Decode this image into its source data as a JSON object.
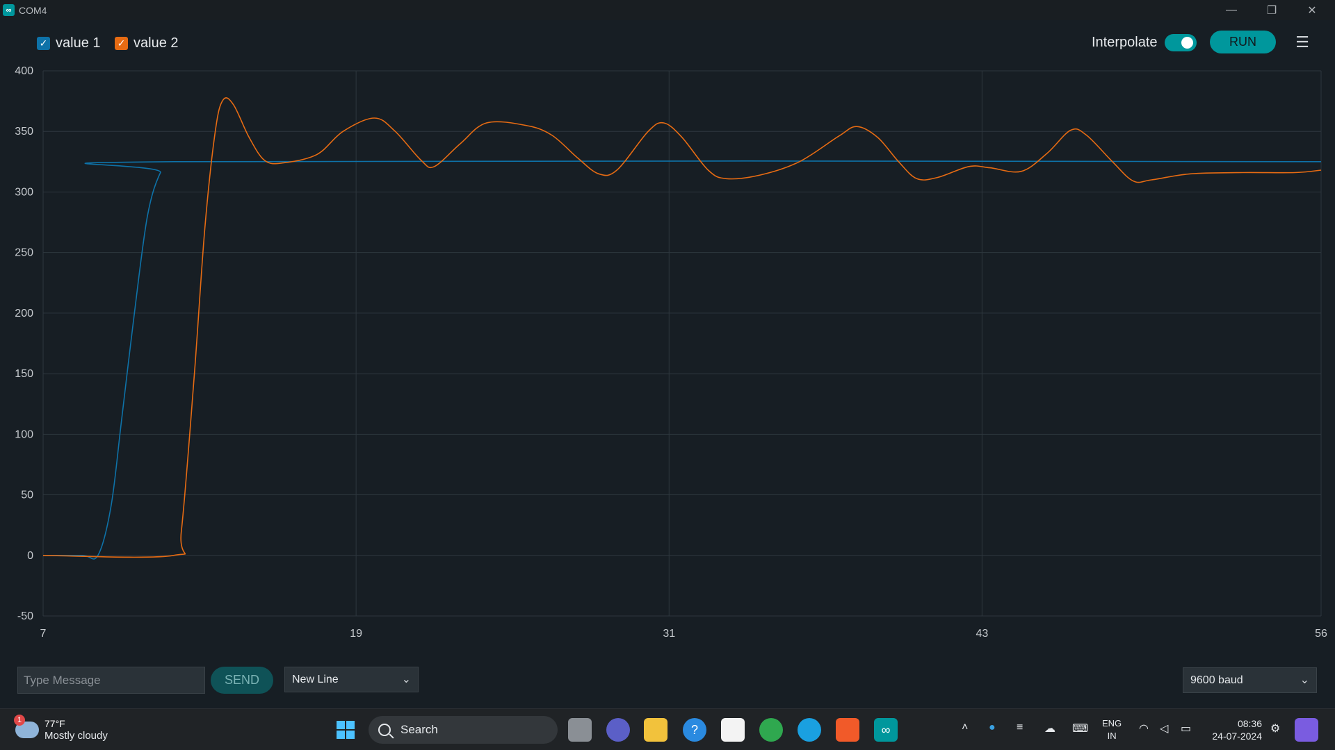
{
  "window": {
    "title": "COM4",
    "icon": "arduino-icon"
  },
  "legend": [
    {
      "label": "value 1",
      "color": "#0e72a8",
      "checked": true
    },
    {
      "label": "value 2",
      "color": "#e66b13",
      "checked": true
    }
  ],
  "toolbar": {
    "interpolate_label": "Interpolate",
    "interpolate_on": true,
    "run_label": "RUN",
    "menu_icon": "clear-list-icon"
  },
  "chart_data": {
    "type": "line",
    "xlim": [
      7,
      56
    ],
    "ylim": [
      -50,
      400
    ],
    "x_ticks": [
      "7",
      "19",
      "31",
      "43",
      "56"
    ],
    "y_ticks": [
      "400",
      "350",
      "300",
      "250",
      "200",
      "150",
      "100",
      "50",
      "0",
      "-50"
    ],
    "grid": true,
    "series": [
      {
        "name": "value 1",
        "color": "#0e72a8",
        "points": [
          [
            7,
            0
          ],
          [
            8.5,
            0
          ],
          [
            9.1,
            0
          ],
          [
            9.6,
            40
          ],
          [
            10.0,
            110
          ],
          [
            10.5,
            200
          ],
          [
            11.0,
            280
          ],
          [
            11.5,
            316
          ],
          [
            12.0,
            325
          ],
          [
            56,
            325
          ]
        ]
      },
      {
        "name": "value 2",
        "color": "#e66b13",
        "points": [
          [
            7,
            0
          ],
          [
            12.0,
            0
          ],
          [
            12.3,
            20
          ],
          [
            12.8,
            150
          ],
          [
            13.2,
            270
          ],
          [
            13.6,
            350
          ],
          [
            13.9,
            376
          ],
          [
            14.3,
            372
          ],
          [
            14.9,
            345
          ],
          [
            15.5,
            326
          ],
          [
            16.2,
            324
          ],
          [
            17.5,
            331
          ],
          [
            18.5,
            350
          ],
          [
            19.7,
            361
          ],
          [
            20.5,
            350
          ],
          [
            21.5,
            326
          ],
          [
            22.0,
            321
          ],
          [
            23.0,
            340
          ],
          [
            24.0,
            357
          ],
          [
            25.5,
            355
          ],
          [
            26.5,
            347
          ],
          [
            27.5,
            328
          ],
          [
            28.3,
            315
          ],
          [
            29.0,
            318
          ],
          [
            30.2,
            350
          ],
          [
            30.8,
            357
          ],
          [
            31.5,
            345
          ],
          [
            32.5,
            318
          ],
          [
            33.2,
            311
          ],
          [
            34.5,
            314
          ],
          [
            36.0,
            325
          ],
          [
            37.5,
            346
          ],
          [
            38.2,
            354
          ],
          [
            39.0,
            345
          ],
          [
            39.8,
            325
          ],
          [
            40.5,
            311
          ],
          [
            41.3,
            312
          ],
          [
            42.5,
            321
          ],
          [
            43.3,
            320
          ],
          [
            44.5,
            317
          ],
          [
            45.5,
            332
          ],
          [
            46.4,
            351
          ],
          [
            47.0,
            347
          ],
          [
            48.0,
            325
          ],
          [
            48.8,
            309
          ],
          [
            49.5,
            310
          ],
          [
            51,
            315
          ],
          [
            53,
            316
          ],
          [
            55,
            316
          ],
          [
            56,
            318
          ]
        ]
      }
    ]
  },
  "input": {
    "placeholder": "Type Message",
    "value": "",
    "send_label": "SEND"
  },
  "line_ending": {
    "selected": "New Line"
  },
  "baud": {
    "selected": "9600 baud"
  },
  "taskbar": {
    "weather": {
      "temp": "77°F",
      "condition": "Mostly cloudy",
      "badge": "1"
    },
    "search_label": "Search",
    "lang_line1": "ENG",
    "lang_line2": "IN",
    "time": "08:36",
    "date": "24-07-2024"
  }
}
